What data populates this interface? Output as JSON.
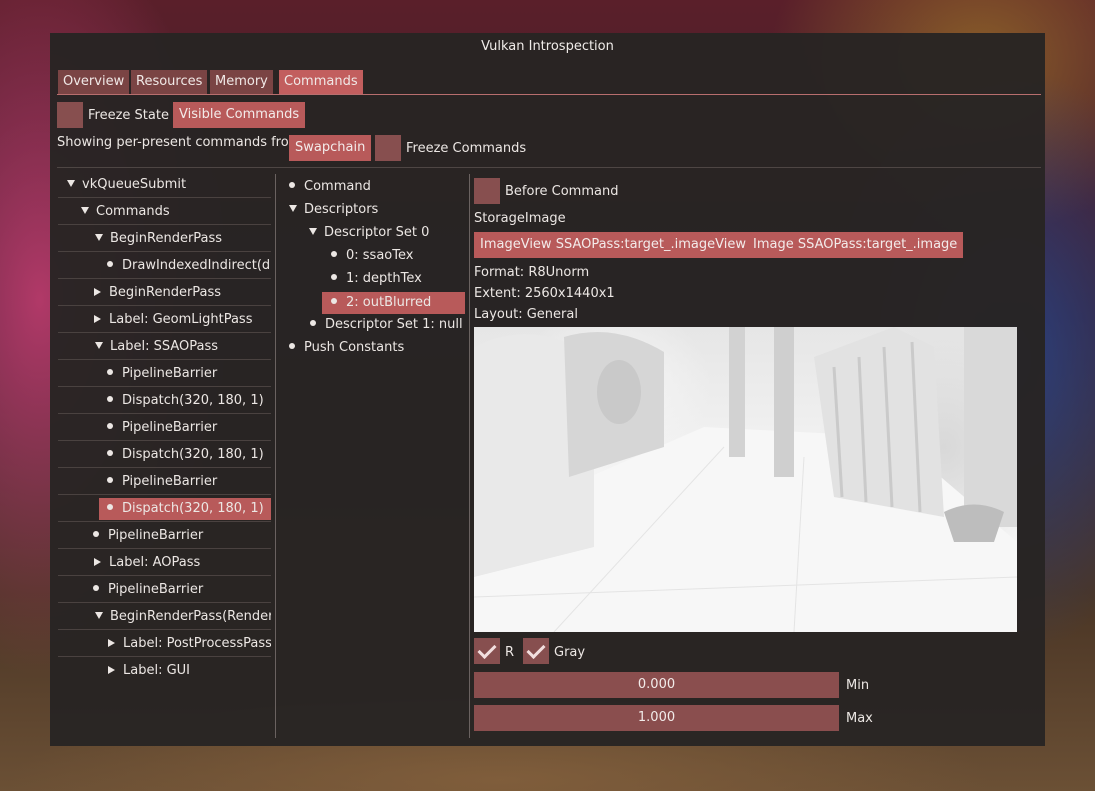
{
  "window": {
    "title": "Vulkan Introspection"
  },
  "tabs": [
    {
      "label": "Overview",
      "active": false
    },
    {
      "label": "Resources",
      "active": false
    },
    {
      "label": "Memory",
      "active": false
    },
    {
      "label": "Commands",
      "active": true
    }
  ],
  "toolbar": {
    "freeze_state_label": "Freeze State",
    "freeze_state_checked": false,
    "visible_commands_label": "Visible Commands",
    "showing_label": "Showing per-present commands from",
    "swapchain_label": "Swapchain",
    "freeze_commands_label": "Freeze Commands",
    "freeze_commands_checked": false
  },
  "command_tree": [
    {
      "label": "vkQueueSubmit",
      "depth": 0,
      "kind": "expanded"
    },
    {
      "label": "Commands",
      "depth": 1,
      "kind": "expanded"
    },
    {
      "label": "BeginRenderPass",
      "depth": 2,
      "kind": "expanded"
    },
    {
      "label": "DrawIndexedIndirect(draw",
      "depth": 3,
      "kind": "leaf"
    },
    {
      "label": "BeginRenderPass",
      "depth": 2,
      "kind": "collapsed"
    },
    {
      "label": "Label: GeomLightPass",
      "depth": 2,
      "kind": "collapsed"
    },
    {
      "label": "Label: SSAOPass",
      "depth": 2,
      "kind": "expanded"
    },
    {
      "label": "PipelineBarrier",
      "depth": 3,
      "kind": "leaf"
    },
    {
      "label": "Dispatch(320, 180, 1)",
      "depth": 3,
      "kind": "leaf"
    },
    {
      "label": "PipelineBarrier",
      "depth": 3,
      "kind": "leaf"
    },
    {
      "label": "Dispatch(320, 180, 1)",
      "depth": 3,
      "kind": "leaf"
    },
    {
      "label": "PipelineBarrier",
      "depth": 3,
      "kind": "leaf"
    },
    {
      "label": "Dispatch(320, 180, 1)",
      "depth": 3,
      "kind": "leaf",
      "selected": true
    },
    {
      "label": "PipelineBarrier",
      "depth": 2,
      "kind": "leaf"
    },
    {
      "label": "Label: AOPass",
      "depth": 2,
      "kind": "collapsed"
    },
    {
      "label": "PipelineBarrier",
      "depth": 2,
      "kind": "leaf"
    },
    {
      "label": "BeginRenderPass(RenderP",
      "depth": 2,
      "kind": "expanded"
    },
    {
      "label": "Label: PostProcessPass",
      "depth": 3,
      "kind": "collapsed"
    },
    {
      "label": "Label: GUI",
      "depth": 3,
      "kind": "collapsed"
    }
  ],
  "descriptor_tree": [
    {
      "label": "Command",
      "depth": 0,
      "kind": "leaf"
    },
    {
      "label": "Descriptors",
      "depth": 0,
      "kind": "expanded"
    },
    {
      "label": "Descriptor Set 0",
      "depth": 1,
      "kind": "expanded"
    },
    {
      "label": "0: ssaoTex",
      "depth": 2,
      "kind": "leaf"
    },
    {
      "label": "1: depthTex",
      "depth": 2,
      "kind": "leaf"
    },
    {
      "label": "2: outBlurred",
      "depth": 2,
      "kind": "leaf",
      "selected": true
    },
    {
      "label": "Descriptor Set 1: null",
      "depth": 1,
      "kind": "leaf"
    },
    {
      "label": "Push Constants",
      "depth": 0,
      "kind": "leaf"
    }
  ],
  "details": {
    "before_command_label": "Before Command",
    "before_command_checked": false,
    "descriptor_type": "StorageImage",
    "image_view_button": "ImageView SSAOPass:target_.imageView",
    "image_button": "Image SSAOPass:target_.image",
    "format": "Format: R8Unorm",
    "extent": "Extent: 2560x1440x1",
    "layout": "Layout: General",
    "channel_r_label": "R",
    "channel_r_checked": true,
    "gray_label": "Gray",
    "gray_checked": true,
    "min_value": "0.000",
    "min_label": "Min",
    "max_value": "1.000",
    "max_label": "Max"
  },
  "colors": {
    "accent": "#b85a5a",
    "accent_dark": "#874f4f",
    "tab_inactive": "#7a4444",
    "panel_bg": "#282423"
  }
}
